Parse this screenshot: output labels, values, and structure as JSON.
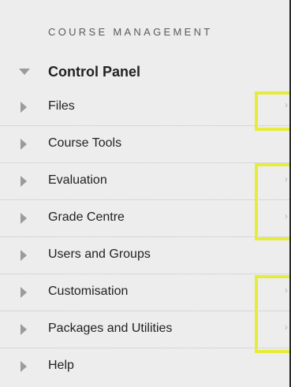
{
  "panel": {
    "heading": "COURSE MANAGEMENT",
    "section_title": "Control Panel",
    "items": [
      {
        "label": "Files",
        "has_submenu": true
      },
      {
        "label": "Course Tools",
        "has_submenu": false
      },
      {
        "label": "Evaluation",
        "has_submenu": true
      },
      {
        "label": "Grade Centre",
        "has_submenu": true
      },
      {
        "label": "Users and Groups",
        "has_submenu": false
      },
      {
        "label": "Customisation",
        "has_submenu": true
      },
      {
        "label": "Packages and Utilities",
        "has_submenu": true
      },
      {
        "label": "Help",
        "has_submenu": false
      }
    ],
    "submenu_glyph": "›"
  },
  "colors": {
    "panel_bg": "#ededed",
    "highlight": "#e6ec3c",
    "triangle": "#9b9b9b",
    "text": "#222222"
  },
  "icons": {
    "section_toggle": "triangle-down-icon",
    "item_toggle": "triangle-right-icon",
    "submenu": "chevron-right-icon"
  }
}
